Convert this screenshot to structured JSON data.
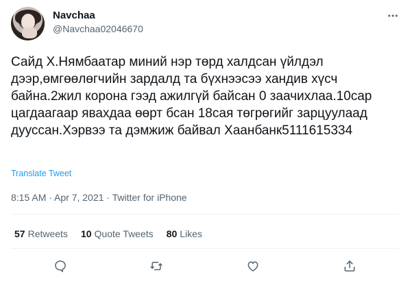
{
  "author": {
    "display_name": "Navchaa",
    "handle": "@Navchaa02046670"
  },
  "tweet": {
    "text": "Сайд Х.Нямбаатар миний нэр төрд халдсан үйлдэл дээр,өмгөөлөгчийн зардалд та бүхнээсээ хандив хүсч байна.2жил корона гээд ажилгүй байсан 0 заачихлаа.10сар цагдаагаар явахдаа өөрт бсан 18сая төгрөгийг зарцуулаад дууссан.Хэрвээ та дэмжиж байвал Хаанбанк5111615334",
    "translate_label": "Translate Tweet",
    "meta": "8:15 AM · Apr 7, 2021 · Twitter for iPhone"
  },
  "stats": {
    "retweets_count": "57",
    "retweets_label": "Retweets",
    "quotes_count": "10",
    "quotes_label": "Quote Tweets",
    "likes_count": "80",
    "likes_label": "Likes"
  },
  "icons": {
    "more": "more-options-icon",
    "reply": "reply-icon",
    "retweet": "retweet-icon",
    "like": "like-icon",
    "share": "share-icon"
  },
  "colors": {
    "text": "#0f1419",
    "secondary": "#536471",
    "link": "#1d9bf0",
    "divider": "#eff3f4"
  }
}
